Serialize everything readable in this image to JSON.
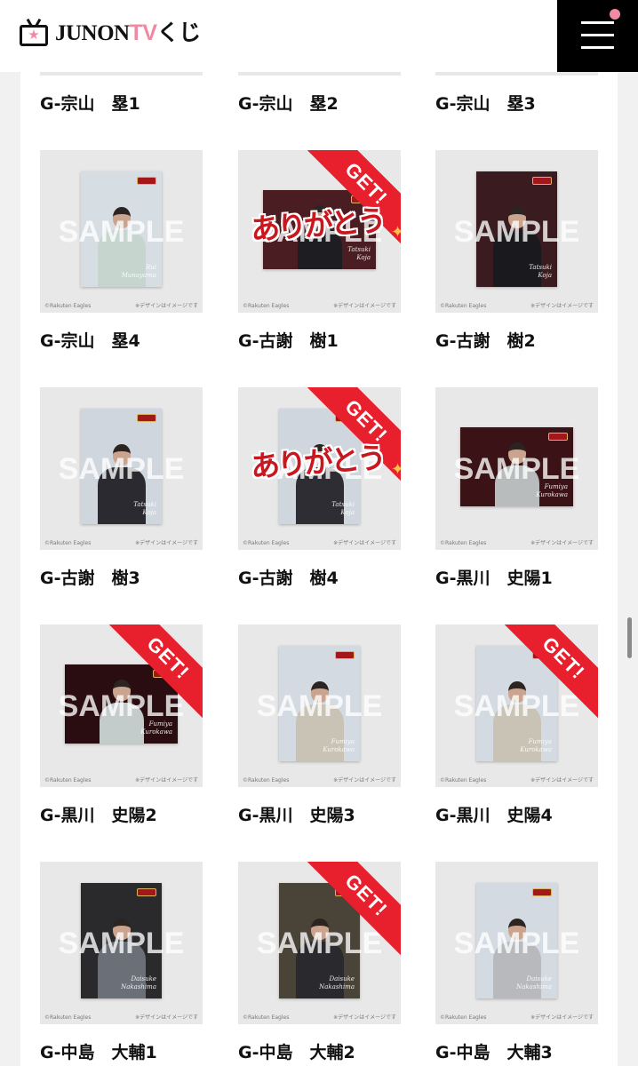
{
  "header": {
    "logo_text": "JUNON",
    "logo_tv": "TV",
    "logo_kuji": "くじ",
    "accent_color": "#f08aa4"
  },
  "top_labels": [
    "G-宗山　塁1",
    "G-宗山　塁2",
    "G-宗山　塁3"
  ],
  "thumb_text": {
    "sample": "SAMPLE",
    "copyright": "©Rakuten Eagles",
    "disclaimer": "※デザインはイメージです",
    "get_badge": "GET!",
    "thanks_overlay": "ありがとう"
  },
  "items": [
    {
      "label": "G-宗山　塁4",
      "get": false,
      "thanks": false,
      "orientation": "portrait",
      "bg": "#d6dde3",
      "outfit": "#c6d6cf",
      "sig": [
        "Rui",
        "Munayama"
      ]
    },
    {
      "label": "G-古謝　樹1",
      "get": true,
      "thanks": true,
      "orientation": "landscape",
      "bg": "#4a1d22",
      "outfit": "#1d1d22",
      "sig": [
        "Tatsuki",
        "Koja"
      ]
    },
    {
      "label": "G-古謝　樹2",
      "get": false,
      "thanks": false,
      "orientation": "portrait",
      "bg": "#3a1c20",
      "outfit": "#1a1a1e",
      "sig": [
        "Tatsuki",
        "Koja"
      ]
    },
    {
      "label": "G-古謝　樹3",
      "get": false,
      "thanks": false,
      "orientation": "portrait",
      "bg": "#cfd6de",
      "outfit": "#2a2a30",
      "sig": [
        "Tatsuki",
        "Koja"
      ]
    },
    {
      "label": "G-古謝　樹4",
      "get": true,
      "thanks": true,
      "orientation": "portrait",
      "bg": "#cfd6de",
      "outfit": "#2d2d33",
      "sig": [
        "Tatsuki",
        "Koja"
      ]
    },
    {
      "label": "G-黒川　史陽1",
      "get": false,
      "thanks": false,
      "orientation": "landscape",
      "bg": "#3b1216",
      "outfit": "#b8bcbc",
      "sig": [
        "Fumiya",
        "Kurokawa"
      ]
    },
    {
      "label": "G-黒川　史陽2",
      "get": true,
      "thanks": false,
      "orientation": "landscape",
      "bg": "#2a0d10",
      "outfit": "#c4cbcb",
      "sig": [
        "Fumiya",
        "Kurokawa"
      ]
    },
    {
      "label": "G-黒川　史陽3",
      "get": false,
      "thanks": false,
      "orientation": "portrait",
      "bg": "#d3dae2",
      "outfit": "#c8c3b4",
      "sig": [
        "Fumiya",
        "Kurokawa"
      ]
    },
    {
      "label": "G-黒川　史陽4",
      "get": true,
      "thanks": false,
      "orientation": "portrait",
      "bg": "#d3dae2",
      "outfit": "#c8c3b4",
      "sig": [
        "Fumiya",
        "Kurokawa"
      ]
    },
    {
      "label": "G-中島　大輔1",
      "get": false,
      "thanks": false,
      "orientation": "portrait",
      "bg": "#2a2a2c",
      "outfit": "#6a6f78",
      "sig": [
        "Daisuke",
        "Nakashima"
      ]
    },
    {
      "label": "G-中島　大輔2",
      "get": true,
      "thanks": false,
      "orientation": "portrait",
      "bg": "#4a4338",
      "outfit": "#2a2a2e",
      "sig": [
        "Daisuke",
        "Nakashima"
      ]
    },
    {
      "label": "G-中島　大輔3",
      "get": false,
      "thanks": false,
      "orientation": "portrait",
      "bg": "#d3dae2",
      "outfit": "#b7b9bd",
      "sig": [
        "Daisuke",
        "Nakashima"
      ]
    }
  ]
}
